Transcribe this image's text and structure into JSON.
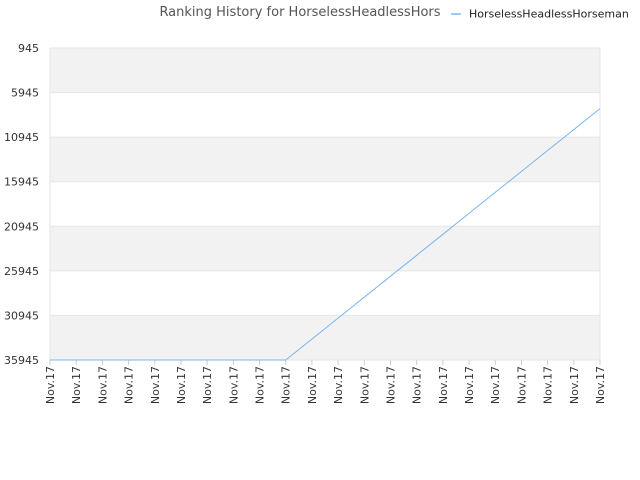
{
  "chart_data": {
    "type": "line",
    "title": "Ranking History for HorselessHeadlessHors",
    "xlabel": "",
    "ylabel": "",
    "y_inverted": true,
    "ylim": [
      945,
      35945
    ],
    "yticks": [
      945,
      5945,
      10945,
      15945,
      20945,
      25945,
      30945,
      35945
    ],
    "grid": true,
    "legend": "top-right",
    "categories": [
      "Nov.17",
      "Nov.17",
      "Nov.17",
      "Nov.17",
      "Nov.17",
      "Nov.17",
      "Nov.17",
      "Nov.17",
      "Nov.17",
      "Nov.17",
      "Nov.17",
      "Nov.17",
      "Nov.17",
      "Nov.17",
      "Nov.17",
      "Nov.17",
      "Nov.17",
      "Nov.17",
      "Nov.17",
      "Nov.17",
      "Nov.17",
      "Nov.17"
    ],
    "series": [
      {
        "name": "HorselessHeadlessHorseman",
        "color": "#7cb5ec",
        "values": [
          35945,
          35945,
          35945,
          35945,
          35945,
          35945,
          35945,
          35945,
          35945,
          35945,
          33595,
          31245,
          28895,
          26545,
          24195,
          21845,
          19495,
          17145,
          14795,
          12445,
          10095,
          7745
        ]
      }
    ],
    "colors": {
      "band": "#f2f2f2",
      "grid": "#e6e6e6",
      "line": "#7cb5ec"
    }
  }
}
